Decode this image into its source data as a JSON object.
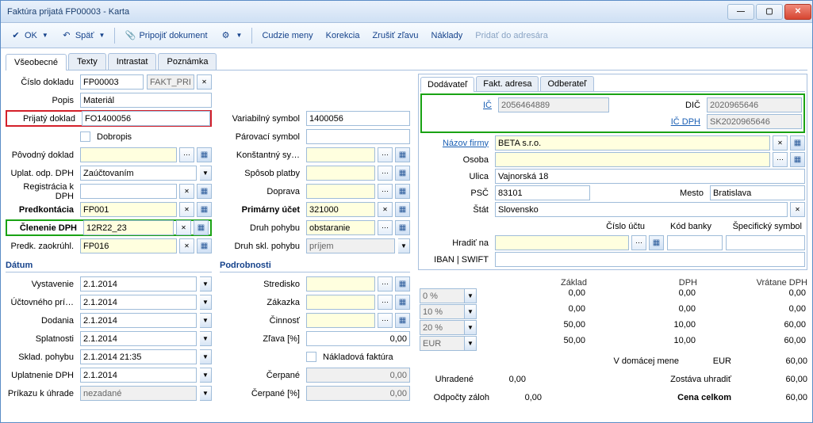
{
  "title": "Faktúra prijatá FP00003 - Karta",
  "toolbar": {
    "ok": "OK",
    "spat": "Späť",
    "pripojit": "Pripojiť dokument",
    "cudzie": "Cudzie meny",
    "korekcia": "Korekcia",
    "zrusit": "Zrušiť zľavu",
    "naklady": "Náklady",
    "pridat": "Pridať do adresára"
  },
  "tabs": {
    "vseobecne": "Všeobecné",
    "texty": "Texty",
    "intrastat": "Intrastat",
    "poznamka": "Poznámka"
  },
  "main": {
    "cislo_dokladu_lbl": "Číslo dokladu",
    "cislo_dokladu": "FP00003",
    "cislo_seria": "FAKT_PRI",
    "popis_lbl": "Popis",
    "popis": "Materiál",
    "prijaty_lbl": "Prijatý doklad",
    "prijaty": "FO1400056",
    "dobropis_lbl": "Dobropis",
    "povodny_lbl": "Pôvodný doklad",
    "povodny": "",
    "uplat_lbl": "Uplat. odp. DPH",
    "uplat": "Zaúčtovaním",
    "reg_lbl": "Registrácia k DPH",
    "reg": "",
    "predk_lbl": "Predkontácia",
    "predk": "FP001",
    "clen_lbl": "Členenie DPH",
    "clen": "12R22_23",
    "zaok_lbl": "Predk. zaokrúhl.",
    "zaok": "FP016",
    "varsym_lbl": "Variabilný symbol",
    "varsym": "1400056",
    "parsym_lbl": "Párovací symbol",
    "parsym": "",
    "konst_lbl": "Konštantný sy…",
    "konst": "",
    "sposob_lbl": "Spôsob platby",
    "sposob": "",
    "doprava_lbl": "Doprava",
    "doprava": "",
    "primucet_lbl": "Primárny účet",
    "primucet": "321000",
    "druhpoh_lbl": "Druh pohybu",
    "druhpoh": "obstaranie",
    "druhskl_lbl": "Druh skl. pohybu",
    "druhskl": "príjem"
  },
  "supplier": {
    "tabs": {
      "dod": "Dodávateľ",
      "fakt": "Fakt. adresa",
      "odb": "Odberateľ"
    },
    "ic_lbl": "IČ",
    "ic": "2056464889",
    "dic_lbl": "DIČ",
    "dic": "2020965646",
    "icdph_lbl": "IČ DPH",
    "icdph": "SK2020965646",
    "nazov_lbl": "Názov firmy",
    "nazov": "BETA s.r.o.",
    "osoba_lbl": "Osoba",
    "osoba": "",
    "ulica_lbl": "Ulica",
    "ulica": "Vajnorská 18",
    "psc_lbl": "PSČ",
    "psc": "83101",
    "mesto_lbl": "Mesto",
    "mesto": "Bratislava",
    "stat_lbl": "Štát",
    "stat": "Slovensko",
    "cislouctu_lbl": "Číslo účtu",
    "kodbanky_lbl": "Kód banky",
    "specsym_lbl": "Špecifický symbol",
    "hradit_lbl": "Hradiť na",
    "hradit": "",
    "iban_lbl": "IBAN | SWIFT",
    "iban": ""
  },
  "datum": {
    "hdr": "Dátum",
    "vyst_lbl": "Vystavenie",
    "vyst": "2.1.2014",
    "ucto_lbl": "Účtovného prí…",
    "ucto": "2.1.2014",
    "dod_lbl": "Dodania",
    "dod": "2.1.2014",
    "spl_lbl": "Splatnosti",
    "spl": "2.1.2014",
    "sklad_lbl": "Sklad. pohybu",
    "sklad": "2.1.2014 21:35",
    "updph_lbl": "Uplatnenie DPH",
    "updph": "2.1.2014",
    "prikaz_lbl": "Príkazu k úhrade",
    "prikaz": "nezadané"
  },
  "podrob": {
    "hdr": "Podrobnosti",
    "stred_lbl": "Stredisko",
    "zak_lbl": "Zákazka",
    "cin_lbl": "Činnosť",
    "zlava_lbl": "Zľava [%]",
    "zlava": "0,00",
    "nakl_lbl": "Nákladová faktúra",
    "cerp_lbl": "Čerpané",
    "cerp": "0,00",
    "cerpp_lbl": "Čerpané [%]",
    "cerpp": "0,00"
  },
  "sums": {
    "zaklad_lbl": "Základ",
    "dph_lbl": "DPH",
    "vratane_lbl": "Vrátane DPH",
    "p0": "0 %",
    "p10": "10 %",
    "p20": "20 %",
    "eur": "EUR",
    "r0": {
      "z": "0,00",
      "d": "0,00",
      "v": "0,00"
    },
    "r10": {
      "z": "0,00",
      "d": "0,00",
      "v": "0,00"
    },
    "r20": {
      "z": "50,00",
      "d": "10,00",
      "v": "60,00"
    },
    "rsum": {
      "z": "50,00",
      "d": "10,00",
      "v": "60,00"
    },
    "vdom_lbl": "V domácej mene",
    "vdom_cur": "EUR",
    "vdom": "60,00",
    "uhr_lbl": "Uhradené",
    "uhr": "0,00",
    "zost_lbl": "Zostáva uhradiť",
    "zost": "60,00",
    "odp_lbl": "Odpočty záloh",
    "odp": "0,00",
    "cena_lbl": "Cena celkom",
    "cena": "60,00"
  }
}
